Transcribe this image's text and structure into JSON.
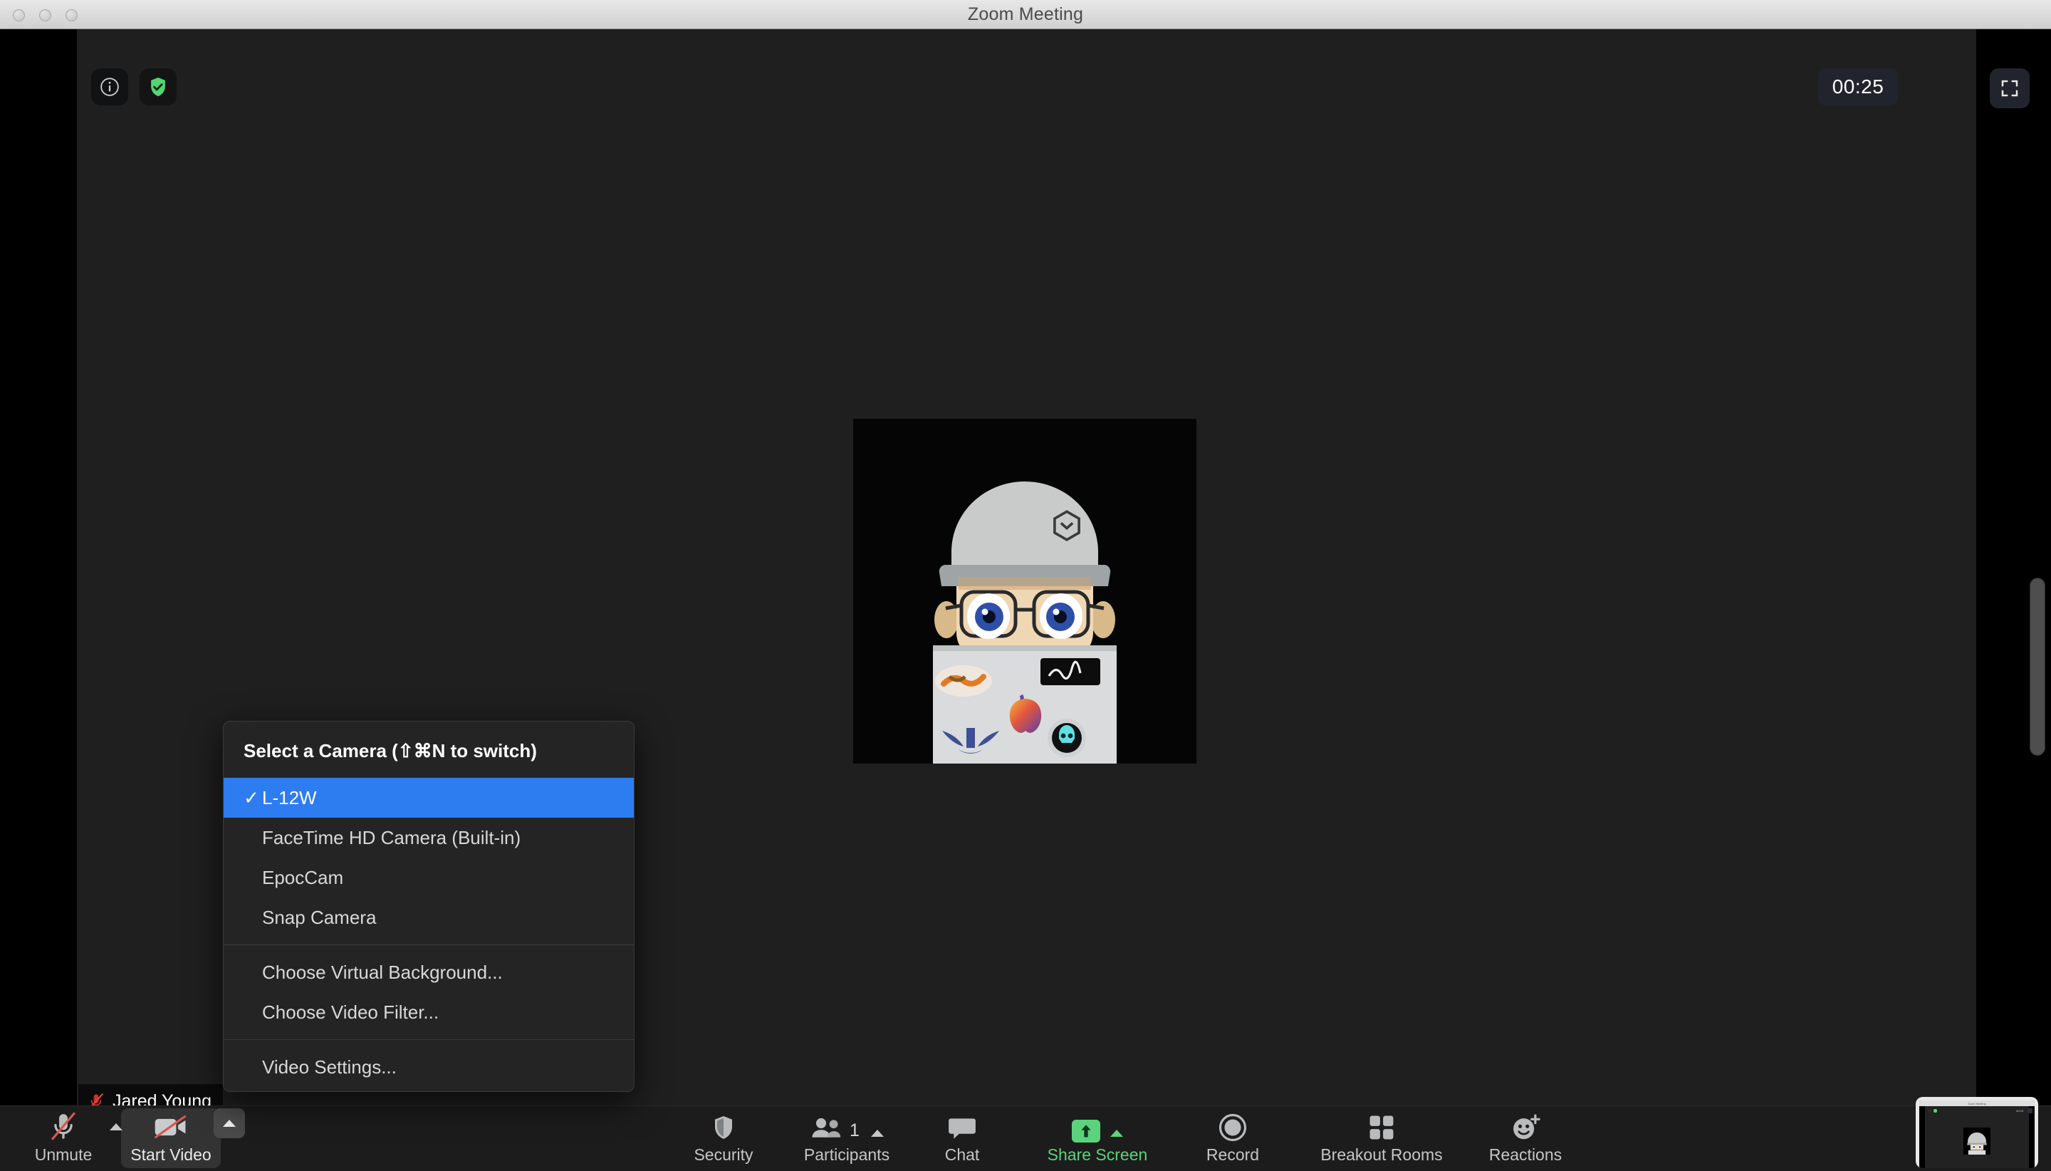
{
  "window": {
    "title": "Zoom Meeting",
    "traffic_lights": [
      "close",
      "minimize",
      "zoom"
    ]
  },
  "stage": {
    "info_icon": "info-icon",
    "security_shield_icon": "shield-check-icon",
    "timer": "00:25",
    "fullscreen_icon": "fullscreen-icon",
    "participant_name": "Jared Young",
    "participant_muted_icon": "microphone-muted-icon",
    "avatar_alt": "cartoon avatar peeking over laptop"
  },
  "camera_menu": {
    "header": "Select a Camera (⇧⌘N to switch)",
    "cameras": [
      {
        "label": "L-12W",
        "selected": true
      },
      {
        "label": "FaceTime HD Camera (Built-in)",
        "selected": false
      },
      {
        "label": "EpocCam",
        "selected": false
      },
      {
        "label": "Snap Camera",
        "selected": false
      }
    ],
    "actions": [
      {
        "label": "Choose Virtual Background..."
      },
      {
        "label": "Choose Video Filter..."
      }
    ],
    "settings": [
      {
        "label": "Video Settings..."
      }
    ],
    "check_glyph": "✓"
  },
  "toolbar": {
    "audio": {
      "label": "Unmute",
      "icon": "microphone-muted-icon"
    },
    "video": {
      "label": "Start Video",
      "icon": "camera-off-icon"
    },
    "security": {
      "label": "Security",
      "icon": "shield-icon"
    },
    "participants": {
      "label": "Participants",
      "icon": "people-icon",
      "count": "1"
    },
    "chat": {
      "label": "Chat",
      "icon": "chat-bubble-icon"
    },
    "share": {
      "label": "Share Screen",
      "icon": "share-arrow-icon"
    },
    "record": {
      "label": "Record",
      "icon": "record-circle-icon"
    },
    "breakout": {
      "label": "Breakout Rooms",
      "icon": "grid-icon"
    },
    "reactions": {
      "label": "Reactions",
      "icon": "smiley-plus-icon"
    }
  },
  "self_preview": {
    "title": "Zoom Meeting",
    "timer": "00:25"
  },
  "colors": {
    "accent_blue": "#2d7cf0",
    "share_green": "#5bd37c",
    "shield_green": "#5bd37c",
    "muted_red": "#d2453d",
    "menu_bg": "#242424",
    "toolbar_bg": "#1c1c1c",
    "stage_bg": "#1f1f1f"
  }
}
